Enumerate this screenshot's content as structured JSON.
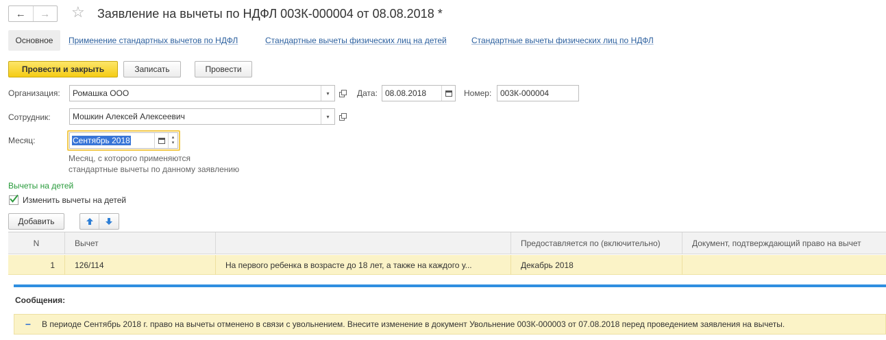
{
  "header": {
    "title": "Заявление на вычеты по НДФЛ 003К-000004 от 08.08.2018 *",
    "back_glyph": "←",
    "forward_glyph": "→",
    "star_glyph": "☆"
  },
  "tabs": [
    {
      "label": "Основное"
    },
    {
      "label": "Применение стандартных вычетов по НДФЛ"
    },
    {
      "label": "Стандартные вычеты физических лиц на детей"
    },
    {
      "label": "Стандартные вычеты физических лиц по НДФЛ"
    }
  ],
  "toolbar": {
    "post_close_label": "Провести и закрыть",
    "save_label": "Записать",
    "post_label": "Провести"
  },
  "form": {
    "org_label": "Организация:",
    "org_value": "Ромашка ООО",
    "date_label": "Дата:",
    "date_value": "08.08.2018",
    "number_label": "Номер:",
    "number_value": "003К-000004",
    "employee_label": "Сотрудник:",
    "employee_value": "Мошкин Алексей Алексеевич",
    "month_label": "Месяц:",
    "month_value": "Сентябрь 2018",
    "month_hint_line1": "Месяц, с которого применяются",
    "month_hint_line2": "стандартные вычеты по данному заявлению"
  },
  "children_section": {
    "title": "Вычеты на детей",
    "checkbox_label": "Изменить вычеты на детей",
    "checkbox_checked": true,
    "add_label": "Добавить"
  },
  "table": {
    "columns": [
      "N",
      "Вычет",
      "",
      "Предоставляется по (включительно)",
      "Документ, подтверждающий право на вычет"
    ],
    "rows": [
      {
        "n": "1",
        "code": "126/114",
        "description": "На первого ребенка в возрасте до 18 лет, а также на каждого у...",
        "until": "Декабрь 2018",
        "document": ""
      }
    ]
  },
  "messages": {
    "title": "Сообщения:",
    "items": [
      {
        "text": "В периоде Сентябрь 2018 г. право на вычеты отменено в связи с увольнением. Внесите изменение в документ Увольнение 003К-000003 от 07.08.2018 перед проведением заявления на вычеты."
      }
    ]
  },
  "colors": {
    "primary_button": "#f5cc15",
    "link": "#2b5f9e",
    "group_title": "#279a3a",
    "selected_row": "#fbf3c7",
    "separator": "#2f8fe0"
  }
}
